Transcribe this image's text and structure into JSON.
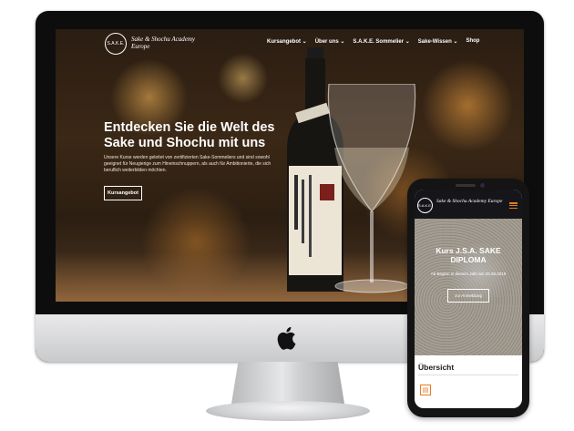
{
  "desktop": {
    "logo_mark": "S.A.K.E.",
    "logo_text": "Sake & Shochu Academy Europe",
    "nav": [
      "Kursangebot ⌄",
      "Über uns ⌄",
      "S.A.K.E. Sommelier ⌄",
      "Sake-Wissen ⌄",
      "Shop"
    ],
    "hero_title": "Entdecken Sie die Welt des Sake und Shochu mit uns",
    "hero_text": "Unsere Kurse werden geleitet von zertifizierten Sake-Sommeliers und sind sowohl geeignet für Neugierige zum Hineinschnuppern, als auch für Ambitionierte, die sich beruflich weiterbilden möchten.",
    "hero_button": "Kursangebot"
  },
  "mobile": {
    "logo_mark": "S.A.K.E.",
    "logo_text": "Sake & Shochu Academy Europe",
    "hero_title": "Kurs J.S.A. SAKE DIPLOMA",
    "hero_sub": "Ab Beginn in diesem Jahr am 26.06.2019",
    "hero_button": "zur Anmeldung",
    "section_title": "Übersicht"
  },
  "colors": {
    "accent": "#e87b1e",
    "header_dark": "#16161a"
  }
}
